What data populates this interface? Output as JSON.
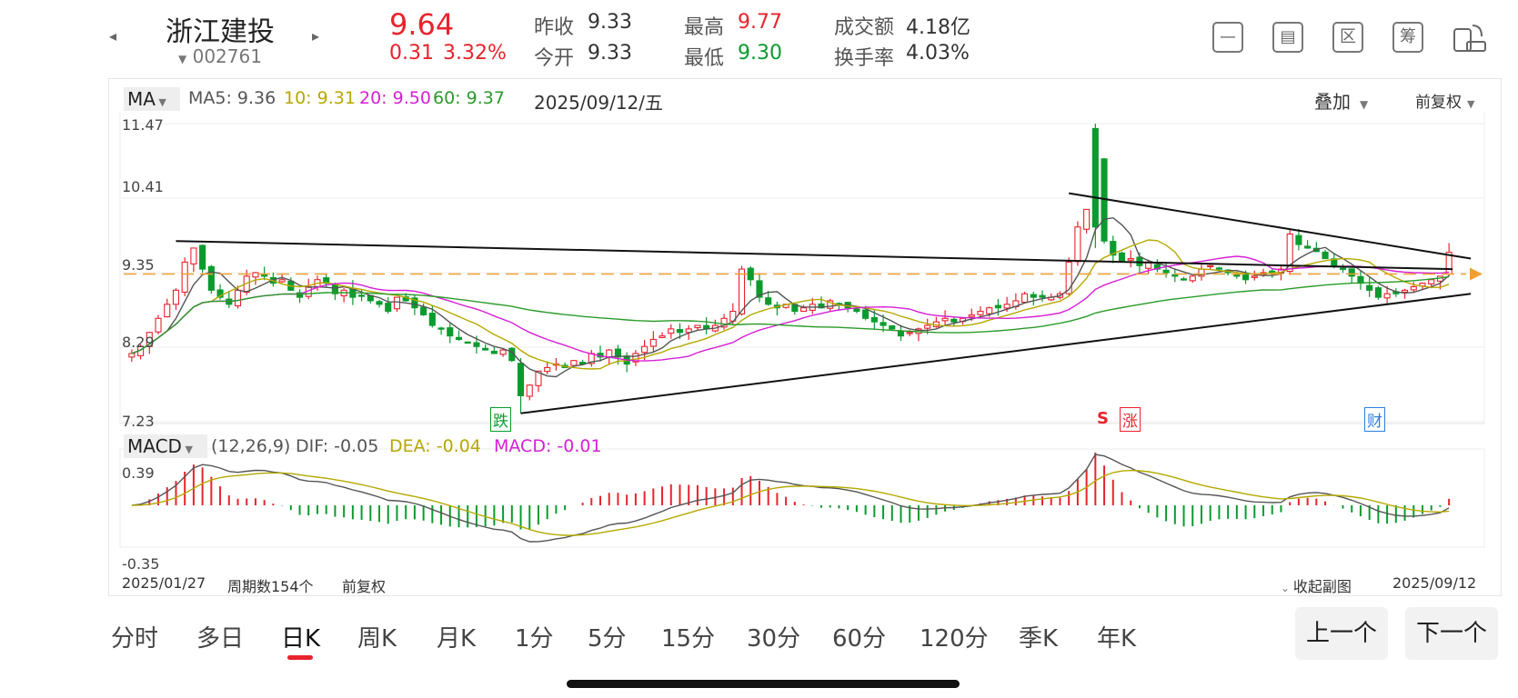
{
  "stock": {
    "name": "浙江建投",
    "code": "002761",
    "price": "9.64",
    "change": "0.31",
    "change_pct": "3.32%",
    "prev_close_label": "昨收",
    "prev_close": "9.33",
    "open_label": "今开",
    "open": "9.33",
    "high_label": "最高",
    "high": "9.77",
    "low_label": "最低",
    "low": "9.30",
    "turnover_label": "成交额",
    "turnover": "4.18亿",
    "rate_label": "换手率",
    "rate": "4.03%"
  },
  "toolbar": {
    "icons": [
      "minus-box-icon",
      "chart-box-icon",
      "zone-box-icon",
      "chip-box-icon",
      "rotate-screen-icon"
    ],
    "chip_label": "筹",
    "zone_label": "区"
  },
  "ma_header": {
    "selector": "MA",
    "ma5": "MA5: 9.36",
    "ma10": "10: 9.31",
    "ma20": "20: 9.50",
    "ma60": "60: 9.37",
    "date": "2025/09/12/五",
    "overlay": "叠加",
    "adjust": "前复权"
  },
  "price_axis": [
    "11.47",
    "10.41",
    "9.35",
    "8.29",
    "7.23"
  ],
  "markers": {
    "fall": "跌",
    "rise": "涨",
    "s": "S",
    "finance": "财"
  },
  "macd_header": {
    "selector": "MACD",
    "params": "(12,26,9)",
    "dif": "DIF: -0.05",
    "dea": "DEA: -0.04",
    "macd": "MACD: -0.01"
  },
  "macd_axis": [
    "0.39",
    "-0.35"
  ],
  "footer": {
    "start_date": "2025/01/27",
    "periods": "周期数154个",
    "adjust": "前复权",
    "collapse": "收起副图",
    "end_date": "2025/09/12"
  },
  "tabs": [
    "分时",
    "多日",
    "日K",
    "周K",
    "月K",
    "1分",
    "5分",
    "15分",
    "30分",
    "60分",
    "120分",
    "季K",
    "年K"
  ],
  "active_tab": "日K",
  "prev_button": "上一个",
  "next_button": "下一个",
  "colors": {
    "up": "#e8232c",
    "down": "#0a9b2e",
    "ma5": "#555555",
    "ma10": "#b5a800",
    "ma20": "#d61fd6",
    "ma60": "#2a9b2a",
    "ref_line": "#f0a030",
    "dif": "#555555",
    "dea": "#b5a800",
    "macd": "#d61fd6"
  },
  "chart_data": {
    "type": "candlestick",
    "start": "2025/01/27",
    "end": "2025/09/12",
    "periods": 154,
    "y_range": [
      7.23,
      11.47
    ],
    "last": {
      "open": 9.33,
      "high": 9.77,
      "low": 9.3,
      "close": 9.64
    },
    "close": [
      8.2,
      8.3,
      8.5,
      8.7,
      8.9,
      9.1,
      9.5,
      9.7,
      9.4,
      9.1,
      9.0,
      8.9,
      9.1,
      9.3,
      9.35,
      9.3,
      9.2,
      9.25,
      9.1,
      9.0,
      9.15,
      9.25,
      9.2,
      9.05,
      9.1,
      9.0,
      9.02,
      8.95,
      8.9,
      8.8,
      9.0,
      8.95,
      8.85,
      8.75,
      8.6,
      8.55,
      8.45,
      8.4,
      8.35,
      8.3,
      8.25,
      8.2,
      8.25,
      8.1,
      7.6,
      7.75,
      7.95,
      8.0,
      8.05,
      8.0,
      8.1,
      8.05,
      8.2,
      8.15,
      8.25,
      8.15,
      8.05,
      8.2,
      8.3,
      8.4,
      8.45,
      8.55,
      8.5,
      8.55,
      8.6,
      8.55,
      8.6,
      8.7,
      8.8,
      9.4,
      9.25,
      9.0,
      8.9,
      8.85,
      8.9,
      8.8,
      8.85,
      8.9,
      8.85,
      8.95,
      8.9,
      8.85,
      8.8,
      8.7,
      8.65,
      8.6,
      8.55,
      8.45,
      8.5,
      8.55,
      8.6,
      8.65,
      8.7,
      8.65,
      8.7,
      8.75,
      8.8,
      8.85,
      8.85,
      8.9,
      8.95,
      9.05,
      9.0,
      9.0,
      9.0,
      9.05,
      9.5,
      10.0,
      10.25,
      11.0,
      9.8,
      9.6,
      9.5,
      9.55,
      9.45,
      9.5,
      9.4,
      9.35,
      9.3,
      9.25,
      9.3,
      9.4,
      9.45,
      9.4,
      9.35,
      9.3,
      9.25,
      9.3,
      9.35,
      9.35,
      9.4,
      9.9,
      9.75,
      9.7,
      9.65,
      9.55,
      9.45,
      9.4,
      9.3,
      9.2,
      9.1,
      9.0,
      9.05,
      9.05,
      9.1,
      9.15,
      9.2,
      9.25,
      9.3,
      9.64
    ]
  }
}
